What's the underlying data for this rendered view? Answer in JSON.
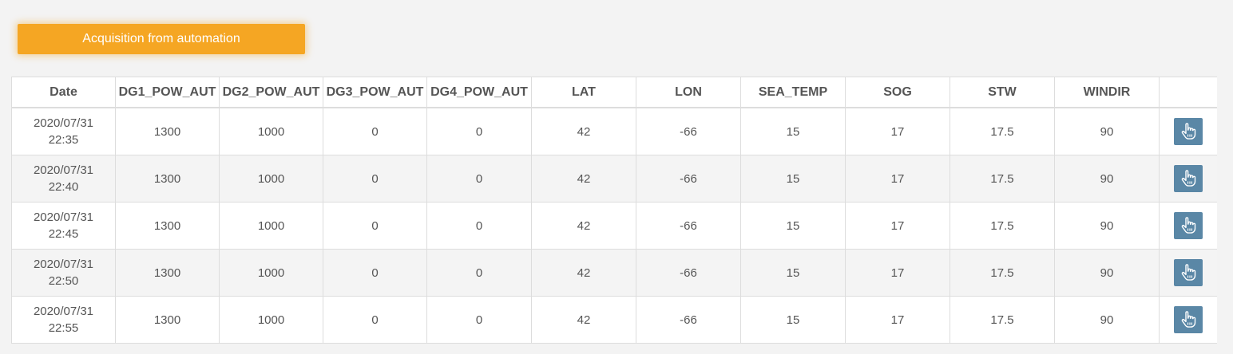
{
  "toolbar": {
    "acquisition_label": "Acquisition from automation"
  },
  "table": {
    "columns": [
      "Date",
      "DG1_POW_AUT",
      "DG2_POW_AUT",
      "DG3_POW_AUT",
      "DG4_POW_AUT",
      "LAT",
      "LON",
      "SEA_TEMP",
      "SOG",
      "STW",
      "WINDIR",
      ""
    ],
    "rows": [
      {
        "date": "2020/07/31",
        "time": "22:35",
        "dg1": "1300",
        "dg2": "1000",
        "dg3": "0",
        "dg4": "0",
        "lat": "42",
        "lon": "-66",
        "sea_temp": "15",
        "sog": "17",
        "stw": "17.5",
        "windir": "90",
        "action_icon": "hand-pointer-icon"
      },
      {
        "date": "2020/07/31",
        "time": "22:40",
        "dg1": "1300",
        "dg2": "1000",
        "dg3": "0",
        "dg4": "0",
        "lat": "42",
        "lon": "-66",
        "sea_temp": "15",
        "sog": "17",
        "stw": "17.5",
        "windir": "90",
        "action_icon": "hand-pointer-icon"
      },
      {
        "date": "2020/07/31",
        "time": "22:45",
        "dg1": "1300",
        "dg2": "1000",
        "dg3": "0",
        "dg4": "0",
        "lat": "42",
        "lon": "-66",
        "sea_temp": "15",
        "sog": "17",
        "stw": "17.5",
        "windir": "90",
        "action_icon": "hand-pointer-icon"
      },
      {
        "date": "2020/07/31",
        "time": "22:50",
        "dg1": "1300",
        "dg2": "1000",
        "dg3": "0",
        "dg4": "0",
        "lat": "42",
        "lon": "-66",
        "sea_temp": "15",
        "sog": "17",
        "stw": "17.5",
        "windir": "90",
        "action_icon": "hand-pointer-icon"
      },
      {
        "date": "2020/07/31",
        "time": "22:55",
        "dg1": "1300",
        "dg2": "1000",
        "dg3": "0",
        "dg4": "0",
        "lat": "42",
        "lon": "-66",
        "sea_temp": "15",
        "sog": "17",
        "stw": "17.5",
        "windir": "90",
        "action_icon": "hand-pointer-icon"
      }
    ]
  },
  "colors": {
    "accent": "#f5a623",
    "action_button": "#5a87a6",
    "background": "#f3f3f3",
    "border": "#dddddd"
  }
}
